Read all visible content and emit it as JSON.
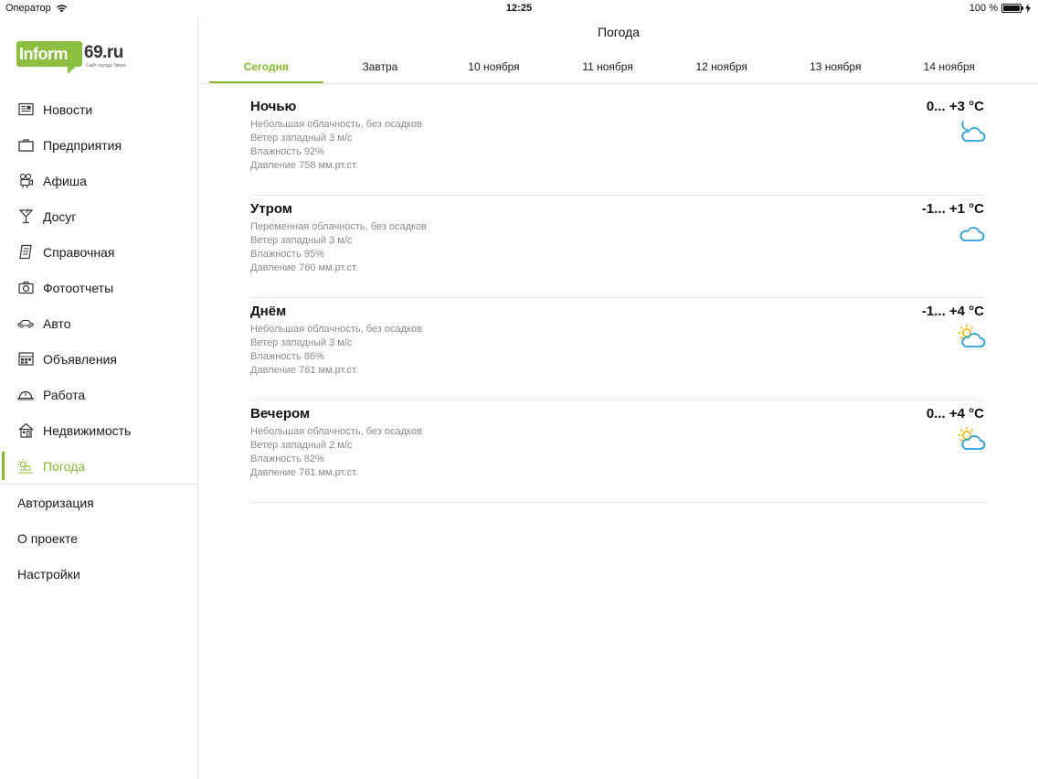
{
  "status_bar": {
    "carrier": "Оператор",
    "time": "12:25",
    "battery": "100 %"
  },
  "logo": {
    "brand": "Inform",
    "domain": "69.ru",
    "tagline": "Сайт города Твери"
  },
  "sidebar": {
    "items": [
      {
        "label": "Новости",
        "icon": "newspaper-icon"
      },
      {
        "label": "Предприятия",
        "icon": "briefcase-icon"
      },
      {
        "label": "Афиша",
        "icon": "film-camera-icon"
      },
      {
        "label": "Досуг",
        "icon": "cocktail-icon"
      },
      {
        "label": "Справочная",
        "icon": "book-icon"
      },
      {
        "label": "Фотоотчеты",
        "icon": "camera-icon"
      },
      {
        "label": "Авто",
        "icon": "car-icon"
      },
      {
        "label": "Объявления",
        "icon": "board-icon"
      },
      {
        "label": "Работа",
        "icon": "hard-hat-icon"
      },
      {
        "label": "Недвижимость",
        "icon": "house-icon"
      },
      {
        "label": "Погода",
        "icon": "weather-icon",
        "active": true
      }
    ],
    "secondary": [
      {
        "label": "Авторизация"
      },
      {
        "label": "О проекте"
      },
      {
        "label": "Настройки"
      }
    ]
  },
  "main": {
    "title": "Погода",
    "tabs": [
      {
        "label": "Сегодня",
        "active": true
      },
      {
        "label": "Завтра"
      },
      {
        "label": "10 ноября"
      },
      {
        "label": "11 ноября"
      },
      {
        "label": "12 ноября"
      },
      {
        "label": "13 ноября"
      },
      {
        "label": "14 ноября"
      }
    ],
    "periods": [
      {
        "title": "Ночью",
        "conditions": "Небольшая облачность, без осадков",
        "wind": "Ветер западный 3 м/с",
        "humidity": "Влажность 92%",
        "pressure": "Давление 758 мм.рт.ст.",
        "temp": "0... +3 °C",
        "icon": "moon-cloud-icon"
      },
      {
        "title": "Утром",
        "conditions": "Переменная облачность, без осадков",
        "wind": "Ветер западный 3 м/с",
        "humidity": "Влажность 95%",
        "pressure": "Давление 760 мм.рт.ст.",
        "temp": "-1... +1 °C",
        "icon": "cloud-icon"
      },
      {
        "title": "Днём",
        "conditions": "Небольшая облачность, без осадков",
        "wind": "Ветер западный 3 м/с",
        "humidity": "Влажность 86%",
        "pressure": "Давление 761 мм.рт.ст.",
        "temp": "-1... +4 °C",
        "icon": "sun-cloud-icon"
      },
      {
        "title": "Вечером",
        "conditions": "Небольшая облачность, без осадков",
        "wind": "Ветер западный 2 м/с",
        "humidity": "Влажность 82%",
        "pressure": "Давление 761 мм.рт.ст.",
        "temp": "0... +4 °C",
        "icon": "sun-cloud-icon"
      }
    ]
  },
  "colors": {
    "accent": "#86b832",
    "logo_green": "#8cbf3f",
    "icon_blue": "#2a9fd6",
    "sun_yellow": "#f2b705",
    "muted_text": "#8a8a8a"
  }
}
